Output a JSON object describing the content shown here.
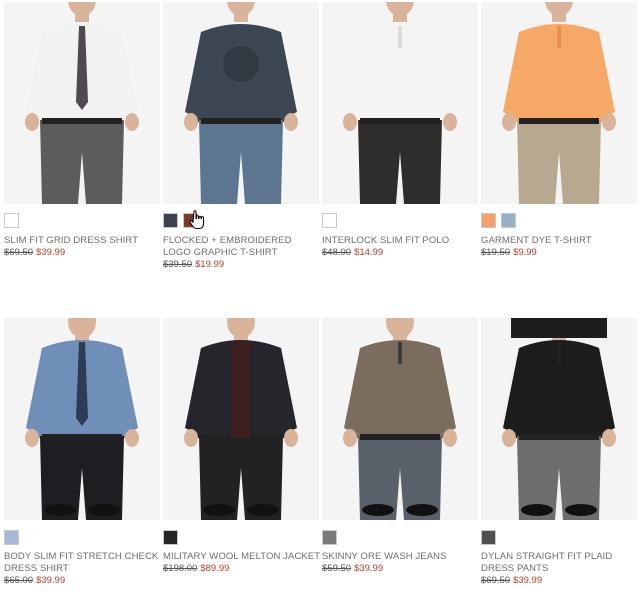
{
  "products": [
    {
      "name": "SLIM FIT GRID DRESS SHIRT",
      "orig_price": "$69.50",
      "sale_price": "$39.99",
      "swatches": [
        "#ffffff"
      ],
      "shirt": "#f2f2f2",
      "pants": "#5c5c5c",
      "accent": "#4e4a50"
    },
    {
      "name": "FLOCKED + EMBROIDERED LOGO GRAPHIC T-SHIRT",
      "orig_price": "$39.50",
      "sale_price": "$19.99",
      "swatches": [
        "#3b4250",
        "#7b3a26"
      ],
      "shirt": "#3d4753",
      "pants": "#5d7690",
      "accent": "#2e3640"
    },
    {
      "name": "INTERLOCK SLIM FIT POLO",
      "orig_price": "$48.00",
      "sale_price": "$14.99",
      "swatches": [
        "#ffffff"
      ],
      "shirt": "#f4f4f4",
      "pants": "#2f2d2c",
      "accent": "#dddddd"
    },
    {
      "name": "GARMENT DYE T-SHIRT",
      "orig_price": "$19.50",
      "sale_price": "$9.99",
      "swatches": [
        "#f5a06a",
        "#95b1c9"
      ],
      "shirt": "#f6a867",
      "pants": "#b7a990",
      "accent": "#e88f4e"
    },
    {
      "name": "BODY SLIM FIT STRETCH CHECK DRESS SHIRT",
      "orig_price": "$65.00",
      "sale_price": "$39.99",
      "swatches": [
        "#a4b8d8"
      ],
      "shirt": "#6f8fb8",
      "pants": "#1e1e22",
      "accent": "#2d3b55"
    },
    {
      "name": "MILITARY WOOL MELTON JACKET",
      "orig_price": "$198.00",
      "sale_price": "$89.99",
      "swatches": [
        "#252528"
      ],
      "shirt": "#25262c",
      "pants": "#222225",
      "accent": "#3c1f1f"
    },
    {
      "name": "SKINNY ORE WASH JEANS",
      "orig_price": "$59.50",
      "sale_price": "$39.99",
      "swatches": [
        "#7a7a7a"
      ],
      "shirt": "#7a6d5e",
      "pants": "#59626a",
      "accent": "#3b3b3b"
    },
    {
      "name": "DYLAN STRAIGHT FIT PLAID DRESS PANTS",
      "orig_price": "$69.50",
      "sale_price": "$39.99",
      "swatches": [
        "#505050"
      ],
      "shirt": "#1c1c1c",
      "pants": "#6d6d6d",
      "accent": "#222222"
    }
  ]
}
